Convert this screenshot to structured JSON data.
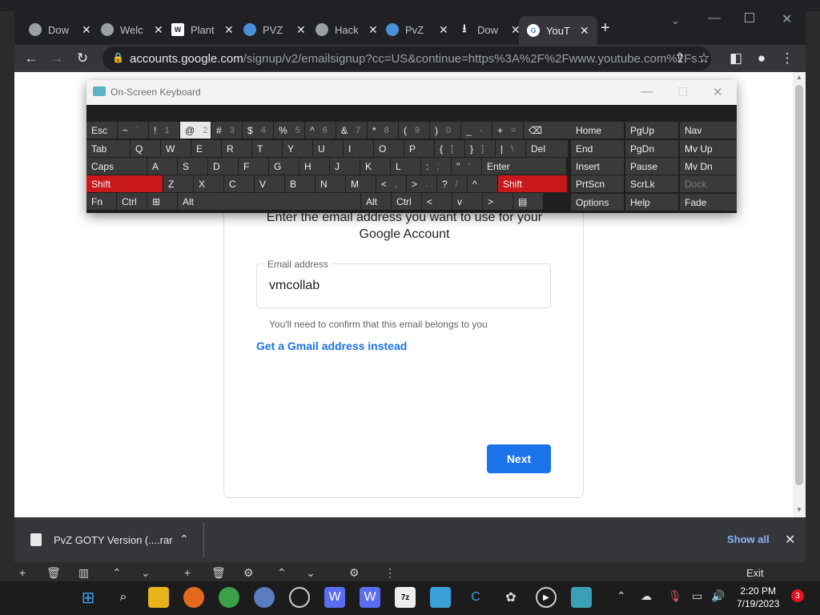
{
  "browser": {
    "tabs": [
      {
        "title": "Dow",
        "icon": "obs-icon"
      },
      {
        "title": "Welc",
        "icon": "globe-icon"
      },
      {
        "title": "Plant",
        "icon": "wix-icon"
      },
      {
        "title": "PVZ",
        "icon": "pvz-icon"
      },
      {
        "title": "Hack",
        "icon": "globe-icon"
      },
      {
        "title": "PvZ",
        "icon": "pvz-icon"
      },
      {
        "title": "Dow",
        "icon": "download-icon"
      },
      {
        "title": "YouT",
        "icon": "google-icon"
      }
    ],
    "url_host": "accounts.google.com",
    "url_rest": "/signup/v2/emailsignup?cc=US&continue=https%3A%2F%2Fwww.youtube.com%2Fs..."
  },
  "page": {
    "subtitle_line1": "Enter the email address you want to use for your",
    "subtitle_line2": "Google Account",
    "email_label": "Email address",
    "email_value": "vmcollab",
    "email_help": "You'll need to confirm that this email belongs to you",
    "gmail_link": "Get a Gmail address instead",
    "next_button": "Next"
  },
  "osk": {
    "title": "On-Screen Keyboard",
    "row1": [
      {
        "label": "Esc",
        "sub": ""
      },
      {
        "label": "~",
        "sub": "`"
      },
      {
        "label": "!",
        "sub": "1"
      },
      {
        "label": "@",
        "sub": "2"
      },
      {
        "label": "#",
        "sub": "3"
      },
      {
        "label": "$",
        "sub": "4"
      },
      {
        "label": "%",
        "sub": "5"
      },
      {
        "label": "^",
        "sub": "6"
      },
      {
        "label": "&",
        "sub": "7"
      },
      {
        "label": "*",
        "sub": "8"
      },
      {
        "label": "(",
        "sub": "9"
      },
      {
        "label": ")",
        "sub": "0"
      },
      {
        "label": "_",
        "sub": "-"
      },
      {
        "label": "+",
        "sub": "="
      },
      {
        "label": "⌫",
        "sub": ""
      }
    ],
    "row2": [
      "Tab",
      "Q",
      "W",
      "E",
      "R",
      "T",
      "Y",
      "U",
      "I",
      "O",
      "P",
      "{ [",
      "} ]",
      "| \\",
      "Del"
    ],
    "row3": [
      "Caps",
      "A",
      "S",
      "D",
      "F",
      "G",
      "H",
      "J",
      "K",
      "L",
      ": ;",
      "\" '",
      "Enter"
    ],
    "row4": [
      "Shift",
      "Z",
      "X",
      "C",
      "V",
      "B",
      "N",
      "M",
      "< ,",
      "> .",
      "? /",
      "^",
      "Shift"
    ],
    "row5": [
      "Fn",
      "Ctrl",
      "⊞",
      "Alt",
      "Alt",
      "Ctrl",
      "<",
      "v",
      ">",
      "▤"
    ],
    "nav_col1": [
      "Home",
      "End",
      "Insert",
      "PrtScn",
      "Options"
    ],
    "nav_col2": [
      "PgUp",
      "PgDn",
      "Pause",
      "ScrLk",
      "Help"
    ],
    "nav_col3": [
      "Nav",
      "Mv Up",
      "Mv Dn",
      "Dock",
      "Fade"
    ]
  },
  "downloads": {
    "file_name": "PvZ GOTY Version (....rar",
    "show_all": "Show all"
  },
  "strip": {
    "exit": "Exit"
  },
  "taskbar": {
    "time": "2:20 PM",
    "date": "7/19/2023",
    "notification_count": "3"
  }
}
